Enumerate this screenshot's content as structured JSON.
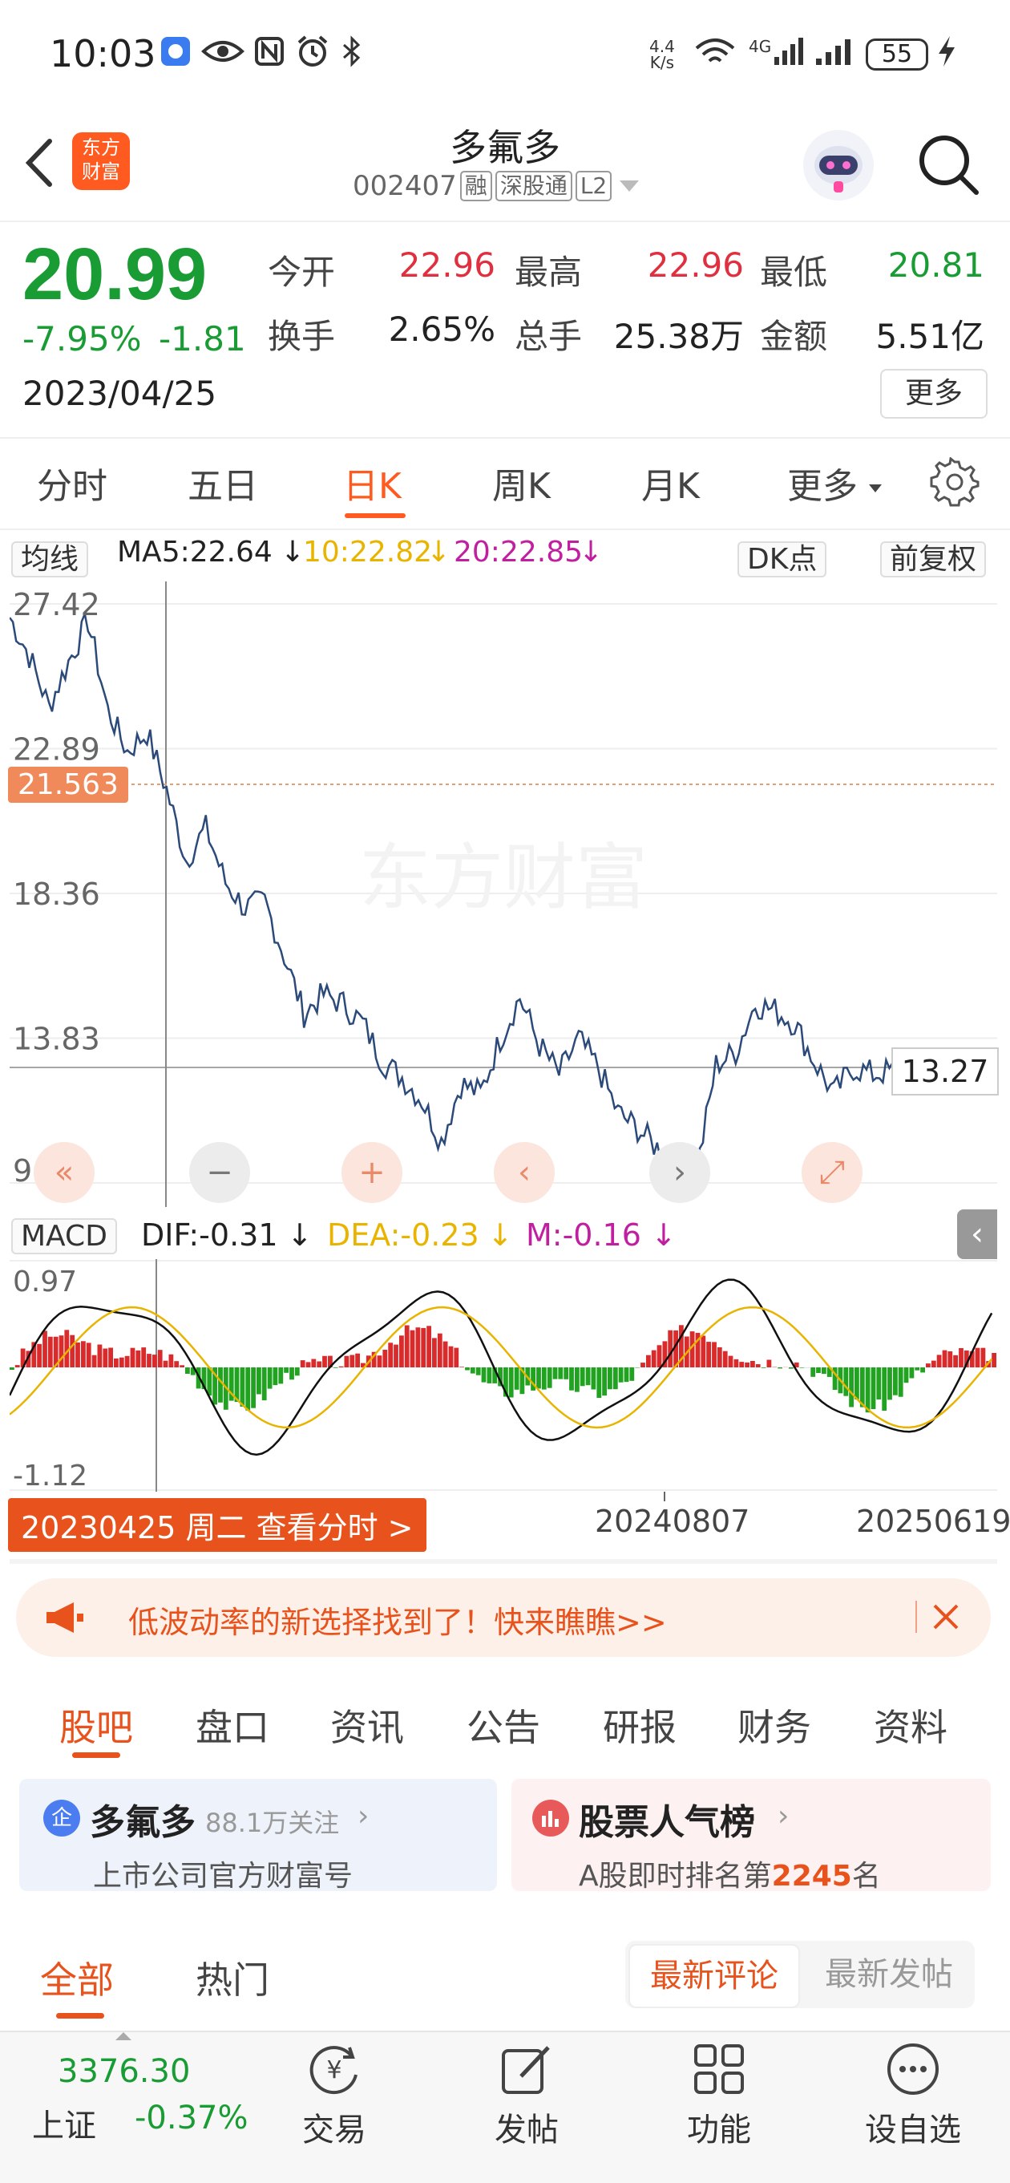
{
  "status_bar": {
    "time": "10:03",
    "net_speed_top": "4.4",
    "net_speed_bottom": "K/s",
    "network": "4G",
    "battery": "55",
    "icons": [
      "app-badge-icon",
      "eye-icon",
      "nfc-icon",
      "alarm-icon",
      "bluetooth-icon",
      "wifi-icon",
      "signal-icon",
      "battery-icon",
      "charging-icon"
    ]
  },
  "header": {
    "back_icon": "back-arrow-icon",
    "logo_line1": "东方",
    "logo_line2": "财富",
    "stock_name": "多氟多",
    "stock_code": "002407",
    "tags": [
      "融",
      "深股通",
      "L2"
    ],
    "robot_icon": "robot-avatar-icon",
    "search_icon": "search-icon"
  },
  "quote": {
    "price": "20.99",
    "change_pct": "-7.95%",
    "change_abs": "-1.81",
    "date": "2023/04/25",
    "open_label": "今开",
    "open": "22.96",
    "high_label": "最高",
    "high": "22.96",
    "low_label": "最低",
    "low": "20.81",
    "turnover_label": "换手",
    "turnover": "2.65%",
    "volume_label": "总手",
    "volume": "25.38万",
    "amount_label": "金额",
    "amount": "5.51亿",
    "more_label": "更多"
  },
  "period_tabs": [
    {
      "label": "分时",
      "active": false
    },
    {
      "label": "五日",
      "active": false
    },
    {
      "label": "日K",
      "active": true
    },
    {
      "label": "周K",
      "active": false
    },
    {
      "label": "月K",
      "active": false
    },
    {
      "label": "更多",
      "active": false
    }
  ],
  "ma_bar": {
    "selector": "均线",
    "ma5": "MA5:22.64",
    "ma10": "10:22.82",
    "ma20": "20:22.85",
    "dk_label": "DK点",
    "adjust_label": "前复权"
  },
  "kline": {
    "y_labels": [
      "27.42",
      "22.89",
      "18.36",
      "13.83",
      "9.30"
    ],
    "crosshair_price": "21.563",
    "last_price": "13.27",
    "watermark": "东方财富"
  },
  "macd": {
    "selector": "MACD",
    "dif": "DIF:-0.31",
    "dea": "DEA:-0.23",
    "m": "M:-0.16",
    "y_top": "0.97",
    "y_bottom": "-1.12"
  },
  "chart_data": {
    "type": "line",
    "ylim": [
      9.3,
      27.42
    ],
    "x": [
      "20230425",
      "20240807",
      "20250619"
    ],
    "series": [
      {
        "values": [
          27.0,
          25.8,
          24.2,
          25.6,
          26.9,
          24.1,
          22.8,
          23.4,
          21.6,
          19.4,
          20.4,
          18.7,
          17.9,
          18.1,
          16.4,
          14.6,
          15.2,
          14.9,
          14.3,
          13.1,
          12.6,
          11.9,
          10.6,
          12.4,
          12.1,
          13.8,
          15.1,
          13.6,
          12.7,
          13.8,
          12.9,
          11.5,
          11.0,
          10.4,
          10.0,
          9.6,
          13.0,
          13.4,
          14.9,
          14.7,
          14.3,
          13.1,
          12.1,
          12.9,
          12.7,
          12.8,
          12.9,
          13.0,
          12.4,
          12.7,
          13.27
        ]
      }
    ]
  },
  "chart_footer": {
    "date_tag": "20230425 周二 查看分时 >",
    "mid_date": "20240807",
    "end_date": "20250619"
  },
  "promo": {
    "text": "低波动率的新选择找到了！快来瞧瞧>>"
  },
  "content_tabs": [
    "股吧",
    "盘口",
    "资讯",
    "公告",
    "研报",
    "财务",
    "资料"
  ],
  "card_company": {
    "name": "多氟多",
    "followers": "88.1万关注",
    "subtitle": "上市公司官方财富号"
  },
  "card_rank": {
    "title": "股票人气榜",
    "prefix": "A股即时排名第",
    "rank": "2245",
    "suffix": "名"
  },
  "sub_tabs": {
    "all": "全部",
    "hot": "热门",
    "latest_comment": "最新评论",
    "latest_post": "最新发帖"
  },
  "bottom_bar": {
    "index_value": "3376.30",
    "index_name": "上证",
    "index_change": "-0.37%",
    "items": [
      "交易",
      "发帖",
      "功能",
      "设自选"
    ]
  },
  "colors": {
    "accent": "#e8521c",
    "up": "#e03040",
    "down": "#1a9c35",
    "line": "#2b4a7a",
    "ma10": "#e8b400",
    "ma20": "#c020a0"
  }
}
